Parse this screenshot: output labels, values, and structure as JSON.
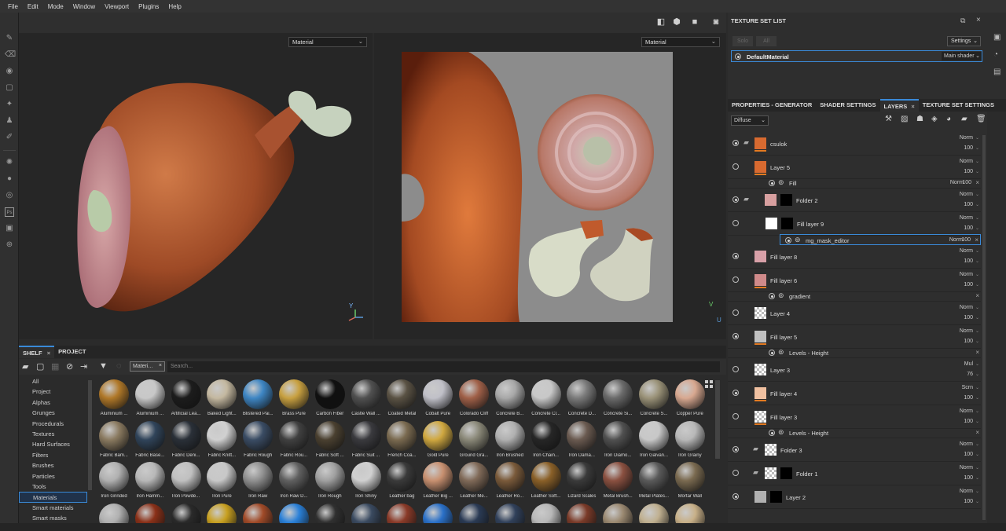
{
  "menu": [
    "File",
    "Edit",
    "Mode",
    "Window",
    "Viewport",
    "Plugins",
    "Help"
  ],
  "viewport": {
    "left_dropdown": "Material",
    "right_dropdown": "Material",
    "axis_x": "X",
    "axis_y": "Y",
    "axis_z": "Z",
    "uv_u": "U",
    "uv_v": "V"
  },
  "texture_set_list": {
    "title": "TEXTURE SET LIST",
    "solo": "Solo",
    "all": "All",
    "settings": "Settings",
    "set_name": "DefaultMaterial",
    "shader": "Main shader"
  },
  "layers_panel": {
    "tabs": [
      "PROPERTIES - GENERATOR",
      "SHADER SETTINGS",
      "LAYERS",
      "TEXTURE SET SETTINGS"
    ],
    "channel": "Diffuse",
    "rows": [
      {
        "name": "csulok",
        "blend": "Norm",
        "opacity": "100"
      },
      {
        "name": "Layer 5",
        "blend": "Norm",
        "opacity": "100"
      },
      {
        "name": "Fill",
        "blend": "Norm",
        "opacity": "100"
      },
      {
        "name": "Folder 2",
        "blend": "Norm",
        "opacity": "100"
      },
      {
        "name": "Fill layer 9",
        "blend": "Norm",
        "opacity": "100"
      },
      {
        "name": "mg_mask_editor",
        "blend": "Norm",
        "opacity": "100"
      },
      {
        "name": "Fill layer 8",
        "blend": "Norm",
        "opacity": "100"
      },
      {
        "name": "Fill layer 6",
        "blend": "Norm",
        "opacity": "100"
      },
      {
        "name": "gradient",
        "blend": "",
        "opacity": ""
      },
      {
        "name": "Layer 4",
        "blend": "Norm",
        "opacity": "100"
      },
      {
        "name": "Fill layer 5",
        "blend": "Norm",
        "opacity": "100"
      },
      {
        "name": "Levels - Height",
        "blend": "",
        "opacity": ""
      },
      {
        "name": "Layer 3",
        "blend": "Mul",
        "opacity": "76"
      },
      {
        "name": "Fill layer 4",
        "blend": "Scrn",
        "opacity": "100"
      },
      {
        "name": "Fill layer 3",
        "blend": "Norm",
        "opacity": "100"
      },
      {
        "name": "Levels - Height",
        "blend": "",
        "opacity": ""
      },
      {
        "name": "Folder 3",
        "blend": "Norm",
        "opacity": "100"
      },
      {
        "name": "Folder 1",
        "blend": "Norm",
        "opacity": "100"
      },
      {
        "name": "Layer 2",
        "blend": "Norm",
        "opacity": "100"
      }
    ]
  },
  "shelf": {
    "tabs": [
      "SHELF",
      "PROJECT"
    ],
    "filter_chip": "Materi...",
    "search_placeholder": "Search...",
    "categories": [
      "All",
      "Project",
      "Alphas",
      "Grunges",
      "Procedurals",
      "Textures",
      "Hard Surfaces",
      "Filters",
      "Brushes",
      "Particles",
      "Tools",
      "Materials",
      "Smart materials",
      "Smart masks"
    ],
    "materials": [
      {
        "name": "Aluminium ...",
        "color": "#b07828"
      },
      {
        "name": "Aluminium ...",
        "color": "#c8c8c8"
      },
      {
        "name": "Artificial Lea...",
        "color": "#1c1c1c"
      },
      {
        "name": "Baked Light...",
        "color": "#c4b8a0"
      },
      {
        "name": "Blistered Pai...",
        "color": "#3e86c4"
      },
      {
        "name": "Brass Pure",
        "color": "#c8a040"
      },
      {
        "name": "Carbon Fiber",
        "color": "#101010"
      },
      {
        "name": "Castle Wall ...",
        "color": "#505050"
      },
      {
        "name": "Coated Metal",
        "color": "#5a5244"
      },
      {
        "name": "Cobalt Pure",
        "color": "#c0c0c8"
      },
      {
        "name": "Colorado Cliff",
        "color": "#a06048"
      },
      {
        "name": "Concrete B...",
        "color": "#a8a8a8"
      },
      {
        "name": "Concrete Cl...",
        "color": "#c8c8c8"
      },
      {
        "name": "Concrete D...",
        "color": "#7a7a7a"
      },
      {
        "name": "Concrete Si...",
        "color": "#6a6a6a"
      },
      {
        "name": "Concrete S...",
        "color": "#9a9278"
      },
      {
        "name": "Copper Pure",
        "color": "#d8a890"
      },
      {
        "name": "Fabric Bam...",
        "color": "#8a7a60"
      },
      {
        "name": "Fabric Base...",
        "color": "#30445a"
      },
      {
        "name": "Fabric Deni...",
        "color": "#2a3038"
      },
      {
        "name": "Fabric Knitt...",
        "color": "#d0d0d0"
      },
      {
        "name": "Fabric Rough",
        "color": "#3a4c64"
      },
      {
        "name": "Fabric Rou...",
        "color": "#404040"
      },
      {
        "name": "Fabric Soft ...",
        "color": "#4a4030"
      },
      {
        "name": "Fabric Suit ...",
        "color": "#3a3a3e"
      },
      {
        "name": "French Coa...",
        "color": "#7a6a50"
      },
      {
        "name": "Gold Pure",
        "color": "#d0a840"
      },
      {
        "name": "Ground Gra...",
        "color": "#8a8878"
      },
      {
        "name": "Iron Brushed",
        "color": "#b0b0b0"
      },
      {
        "name": "Iron Chain...",
        "color": "#262626"
      },
      {
        "name": "Iron Dama...",
        "color": "#6a5a50"
      },
      {
        "name": "Iron Diamo...",
        "color": "#505050"
      },
      {
        "name": "Iron Galvan...",
        "color": "#c8c8c8"
      },
      {
        "name": "Iron Grainy",
        "color": "#b8b8b8"
      },
      {
        "name": "Iron Grinded",
        "color": "#b0b0b0"
      },
      {
        "name": "Iron Hamm...",
        "color": "#b8b8b8"
      },
      {
        "name": "Iron Powde...",
        "color": "#c0c0c0"
      },
      {
        "name": "Iron Pure",
        "color": "#c8c8c8"
      },
      {
        "name": "Iron Raw",
        "color": "#909090"
      },
      {
        "name": "Iron Raw D...",
        "color": "#606060"
      },
      {
        "name": "Iron Rough",
        "color": "#a0a0a0"
      },
      {
        "name": "Iron Shiny",
        "color": "#d0d0d0"
      },
      {
        "name": "Leather bag",
        "color": "#3a3a3a"
      },
      {
        "name": "Leather Big ...",
        "color": "#c89070"
      },
      {
        "name": "Leather Me...",
        "color": "#806a58"
      },
      {
        "name": "Leather Ro...",
        "color": "#7a5a3a"
      },
      {
        "name": "Leather Soft...",
        "color": "#8a6028"
      },
      {
        "name": "Lizard Scales",
        "color": "#3a3a3a"
      },
      {
        "name": "Metal Brush...",
        "color": "#8a5040"
      },
      {
        "name": "Metal Plates...",
        "color": "#5a5a5a"
      },
      {
        "name": "Mortar Wall",
        "color": "#7a6a50"
      },
      {
        "name": "",
        "color": "#b0b0b0"
      },
      {
        "name": "",
        "color": "#8a3018"
      },
      {
        "name": "",
        "color": "#2a2a2a"
      },
      {
        "name": "",
        "color": "#c8a020"
      },
      {
        "name": "",
        "color": "#a04a28"
      },
      {
        "name": "",
        "color": "#2a80d8"
      },
      {
        "name": "",
        "color": "#303030"
      },
      {
        "name": "",
        "color": "#3a4a60"
      },
      {
        "name": "",
        "color": "#8a3a28"
      },
      {
        "name": "",
        "color": "#2a70c8"
      },
      {
        "name": "",
        "color": "#2a3a54"
      },
      {
        "name": "",
        "color": "#30405a"
      },
      {
        "name": "",
        "color": "#b8b8b8"
      },
      {
        "name": "",
        "color": "#7a3a28"
      },
      {
        "name": "",
        "color": "#9a8870"
      },
      {
        "name": "",
        "color": "#c0b090"
      },
      {
        "name": "",
        "color": "#c8b088"
      }
    ]
  }
}
